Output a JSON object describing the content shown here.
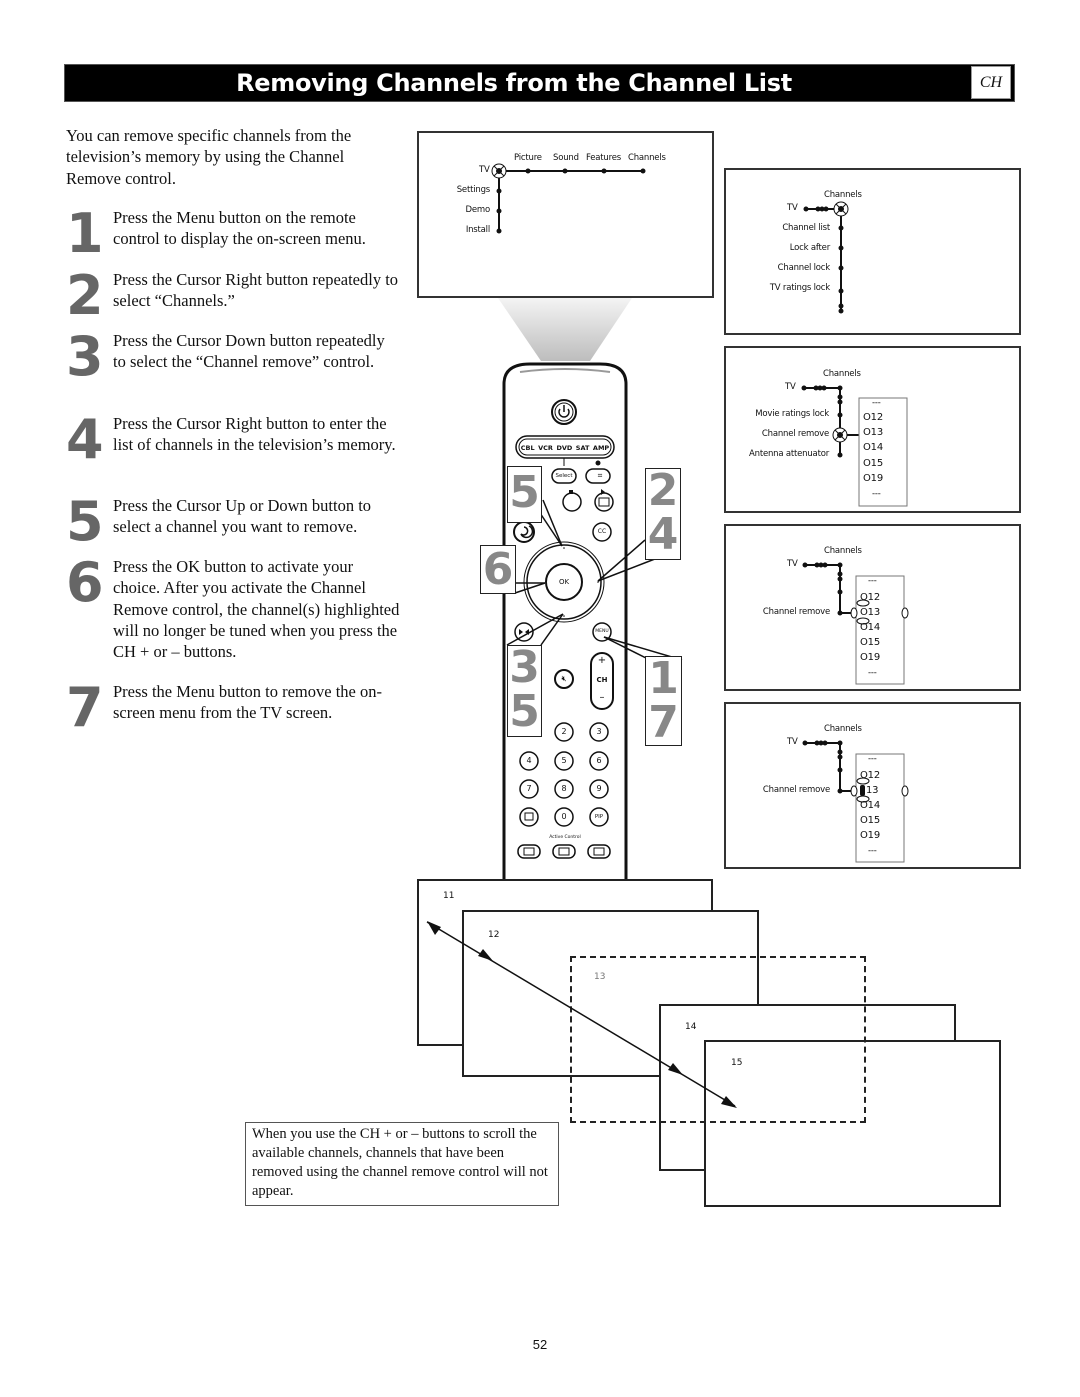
{
  "header": {
    "title": "Removing Channels from the Channel List",
    "section_tab": "CH"
  },
  "intro": "You can remove specific channels from the television’s memory by using the Channel Remove control.",
  "steps": [
    {
      "number": "1",
      "text": "Press the Menu button on the remote control to display the on-screen menu."
    },
    {
      "number": "2",
      "text": "Press the Cursor Right button repeatedly to select “Channels.”"
    },
    {
      "number": "3",
      "text": "Press the Cursor Down button repeatedly to select the “Channel remove” control."
    },
    {
      "number": "4",
      "text": "Press the Cursor Right button to enter the list of channels in the television’s memory."
    },
    {
      "number": "5",
      "text": "Press the Cursor Up or Down button to select a channel you want to remove."
    },
    {
      "number": "6",
      "text": "Press the OK button to activate your choice. After you activate the Channel Remove control, the channel(s) highlighted will no longer be tuned when you press the CH + or – buttons."
    },
    {
      "number": "7",
      "text": "Press the Menu button to remove the on-screen menu from the TV screen."
    }
  ],
  "screens": {
    "main_menu": {
      "root": "TV",
      "top_items": [
        "Picture",
        "Sound",
        "Features",
        "Channels"
      ],
      "side_items": [
        "Settings",
        "Demo",
        "Install"
      ]
    },
    "channels_menu": {
      "root": "TV",
      "header": "Channels",
      "items": [
        "Channel list",
        "Lock after",
        "Channel lock",
        "TV ratings lock"
      ]
    },
    "channel_remove_menu": {
      "root": "TV",
      "header": "Channels",
      "items": [
        "Movie ratings lock",
        "Channel remove",
        "Antenna attenuator"
      ],
      "list_top": "---",
      "channels": [
        "12",
        "13",
        "14",
        "15",
        "19"
      ],
      "list_bottom": "---"
    },
    "channel_select": {
      "root": "TV",
      "header": "Channels",
      "item": "Channel remove",
      "list_top": "---",
      "channels": [
        "12",
        "13",
        "14",
        "15",
        "19"
      ],
      "list_bottom": "---",
      "highlighted": "13"
    },
    "channel_removed": {
      "root": "TV",
      "header": "Channels",
      "item": "Channel remove",
      "list_top": "---",
      "channels": [
        "12",
        "13",
        "14",
        "15",
        "19"
      ],
      "list_bottom": "---",
      "removed": "13"
    }
  },
  "remote": {
    "source_buttons": [
      "CBL",
      "VCR",
      "DVD",
      "SAT",
      "AMP"
    ],
    "select_label": "Select",
    "ok_label": "OK",
    "cc_label": "CC",
    "menu_label": "MENU",
    "ch_label": "CH",
    "ch_plus": "+",
    "ch_minus": "–",
    "digits": [
      "2",
      "3",
      "4",
      "5",
      "6",
      "7",
      "8",
      "9",
      "0"
    ],
    "pip_label": "PIP",
    "active_control_label": "Active Control",
    "callouts": {
      "left_top": "5",
      "right_top": "2\n4",
      "left_mid": "6",
      "left_bottom": "3\n5",
      "right_bottom": "1\n7"
    }
  },
  "channel_frames": [
    "11",
    "12",
    "13",
    "14",
    "15"
  ],
  "caption": "When you use the CH + or – buttons to scroll the available channels, channels that have been removed using the channel remove control will not appear.",
  "page_number": "52"
}
